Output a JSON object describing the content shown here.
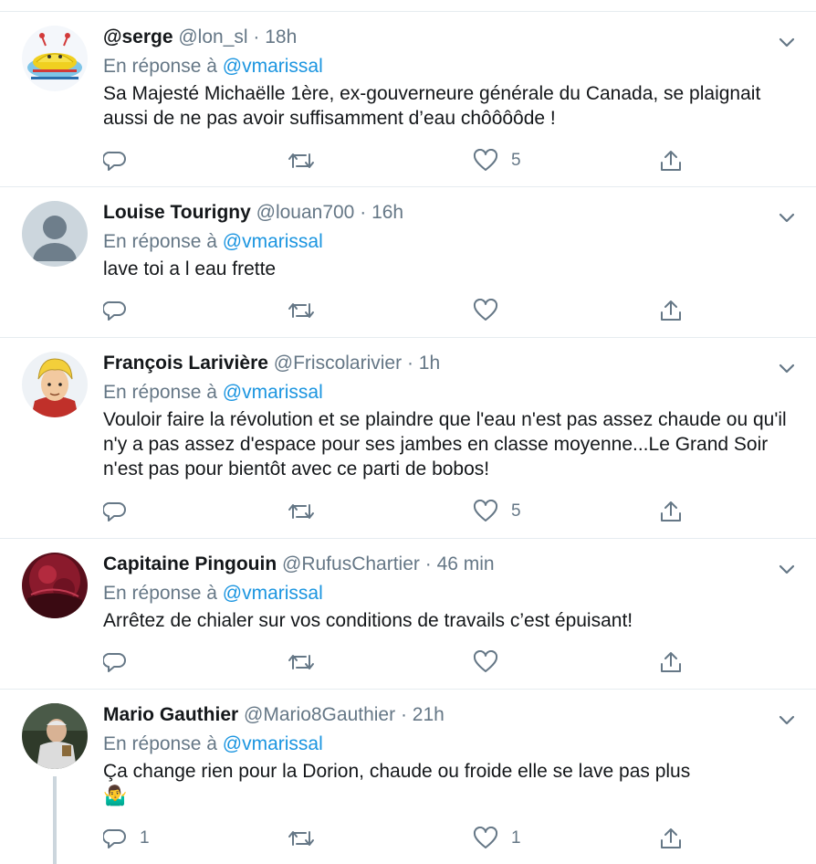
{
  "reply_prefix": "En réponse à",
  "colors": {
    "link": "#1b95e0",
    "muted": "#657786",
    "text": "#14171a",
    "divider": "#e6ecf0"
  },
  "tweets": [
    {
      "name": "@serge",
      "handle": "@lon_sl",
      "time": "18h",
      "reply_to": "@vmarissal",
      "text": "Sa Majesté Michaëlle 1ère, ex-gouverneure générale du Canada, se plaignait aussi de ne pas avoir suffisamment d’eau chôôôôde !",
      "replies": "",
      "retweets": "",
      "likes": "5"
    },
    {
      "name": "Louise Tourigny",
      "handle": "@louan700",
      "time": "16h",
      "reply_to": "@vmarissal",
      "text": "lave toi a l eau frette",
      "replies": "",
      "retweets": "",
      "likes": ""
    },
    {
      "name": "François Larivière",
      "handle": "@Friscolarivier",
      "time": "1h",
      "reply_to": "@vmarissal",
      "text": "Vouloir faire la révolution et se plaindre que l'eau n'est pas assez chaude ou qu'il n'y a pas assez d'espace pour ses jambes en classe moyenne...Le Grand Soir n'est pas pour bientôt avec ce parti de bobos!",
      "replies": "",
      "retweets": "",
      "likes": "5"
    },
    {
      "name": "Capitaine Pingouin",
      "handle": "@RufusChartier",
      "time": "46 min",
      "reply_to": "@vmarissal",
      "text": "Arrêtez de chialer sur vos conditions de travails c’est épuisant!",
      "replies": "",
      "retweets": "",
      "likes": ""
    },
    {
      "name": "Mario Gauthier",
      "handle": "@Mario8Gauthier",
      "time": "21h",
      "reply_to": "@vmarissal",
      "text": "Ça change rien pour la Dorion, chaude ou froide elle se lave pas plus",
      "emoji": "🤷‍♂️",
      "replies": "1",
      "retweets": "",
      "likes": "1"
    }
  ]
}
